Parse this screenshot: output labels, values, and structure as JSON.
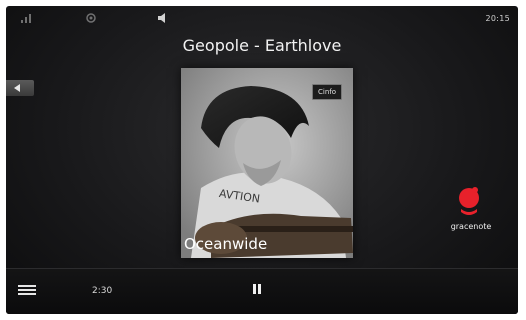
{
  "status": {
    "time": "20:15",
    "icons": [
      "signal-icon",
      "gps-icon",
      "volume-icon"
    ]
  },
  "now_playing": {
    "title": "Geopole - Earthlove",
    "album": "Oceanwide",
    "elapsed": "2:30",
    "info_badge": "Cinfo"
  },
  "brand": {
    "name": "gracenote",
    "accent": "#e8212b"
  },
  "controls": {
    "back_icon": "chevron-left-icon",
    "list_icon": "list-icon",
    "pause_icon": "pause-icon"
  }
}
